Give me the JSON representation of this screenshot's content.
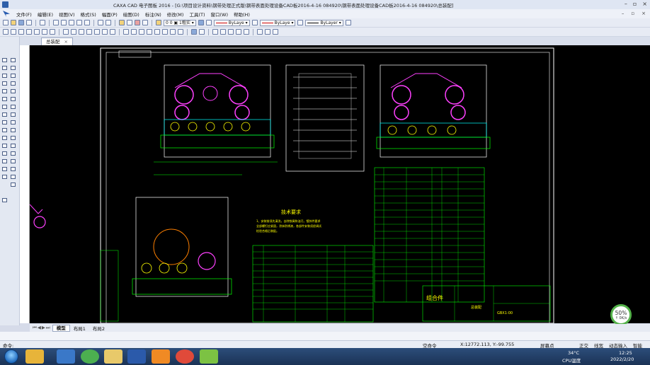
{
  "window": {
    "title": "CAXA CAD 电子图板 2016 - [G:\\项目设计资料\\钢带处理正式版\\钢带表面处理设备CAD板2016-4-16 084920\\钢带表面处理设备CAD板2016-4-16 084920\\总装配]",
    "controls": [
      "–",
      "▫",
      "×"
    ]
  },
  "menu": {
    "items": [
      "文件(F)",
      "编辑(E)",
      "视图(V)",
      "格式(S)",
      "幅面(P)",
      "绘图(D)",
      "标注(N)",
      "修改(M)",
      "工具(T)",
      "窗口(W)",
      "帮助(H)"
    ],
    "right_controls": [
      "–",
      "▫",
      "×"
    ]
  },
  "toolbar": {
    "layer_combo": "0 0 ▣ 1粗实 ▾",
    "color_combo": "ByLaye ▾",
    "linetype_combo": "ByLaye ▾",
    "lineweight_combo": "ByLayer ▾"
  },
  "document_tab": {
    "label": "总装配",
    "close": "×"
  },
  "layout_tabs": {
    "nav": "⏮◀▶⏭",
    "items": [
      "模型",
      "布局1",
      "布局2"
    ],
    "active": "模型"
  },
  "drawing": {
    "title_block_name": "组合件",
    "title_block_code": "GBX1-00",
    "title_block_label": "总装配",
    "tech_req_title": "技术要求",
    "tech_req_lines": [
      "1、安装前须先清洗，去除铁屑和油污。镀锌件要求",
      "全部螺钉应紧固，涂抹防锈漆，各部件安装须经调试",
      "检验合格后装配。"
    ]
  },
  "status": {
    "left": "命令:",
    "mode": "空命令",
    "coords": "X:12772.113, Y:-99.755",
    "snap": "屏幕点",
    "items": [
      "正交",
      "线宽",
      "动态输入",
      "智能"
    ]
  },
  "perf": {
    "value": "50%",
    "sub": "↑ 0K/s"
  },
  "taskbar": {
    "weather": "34°C",
    "cpu": "CPU温度",
    "time": "12:25",
    "date": "2022/2/20"
  }
}
